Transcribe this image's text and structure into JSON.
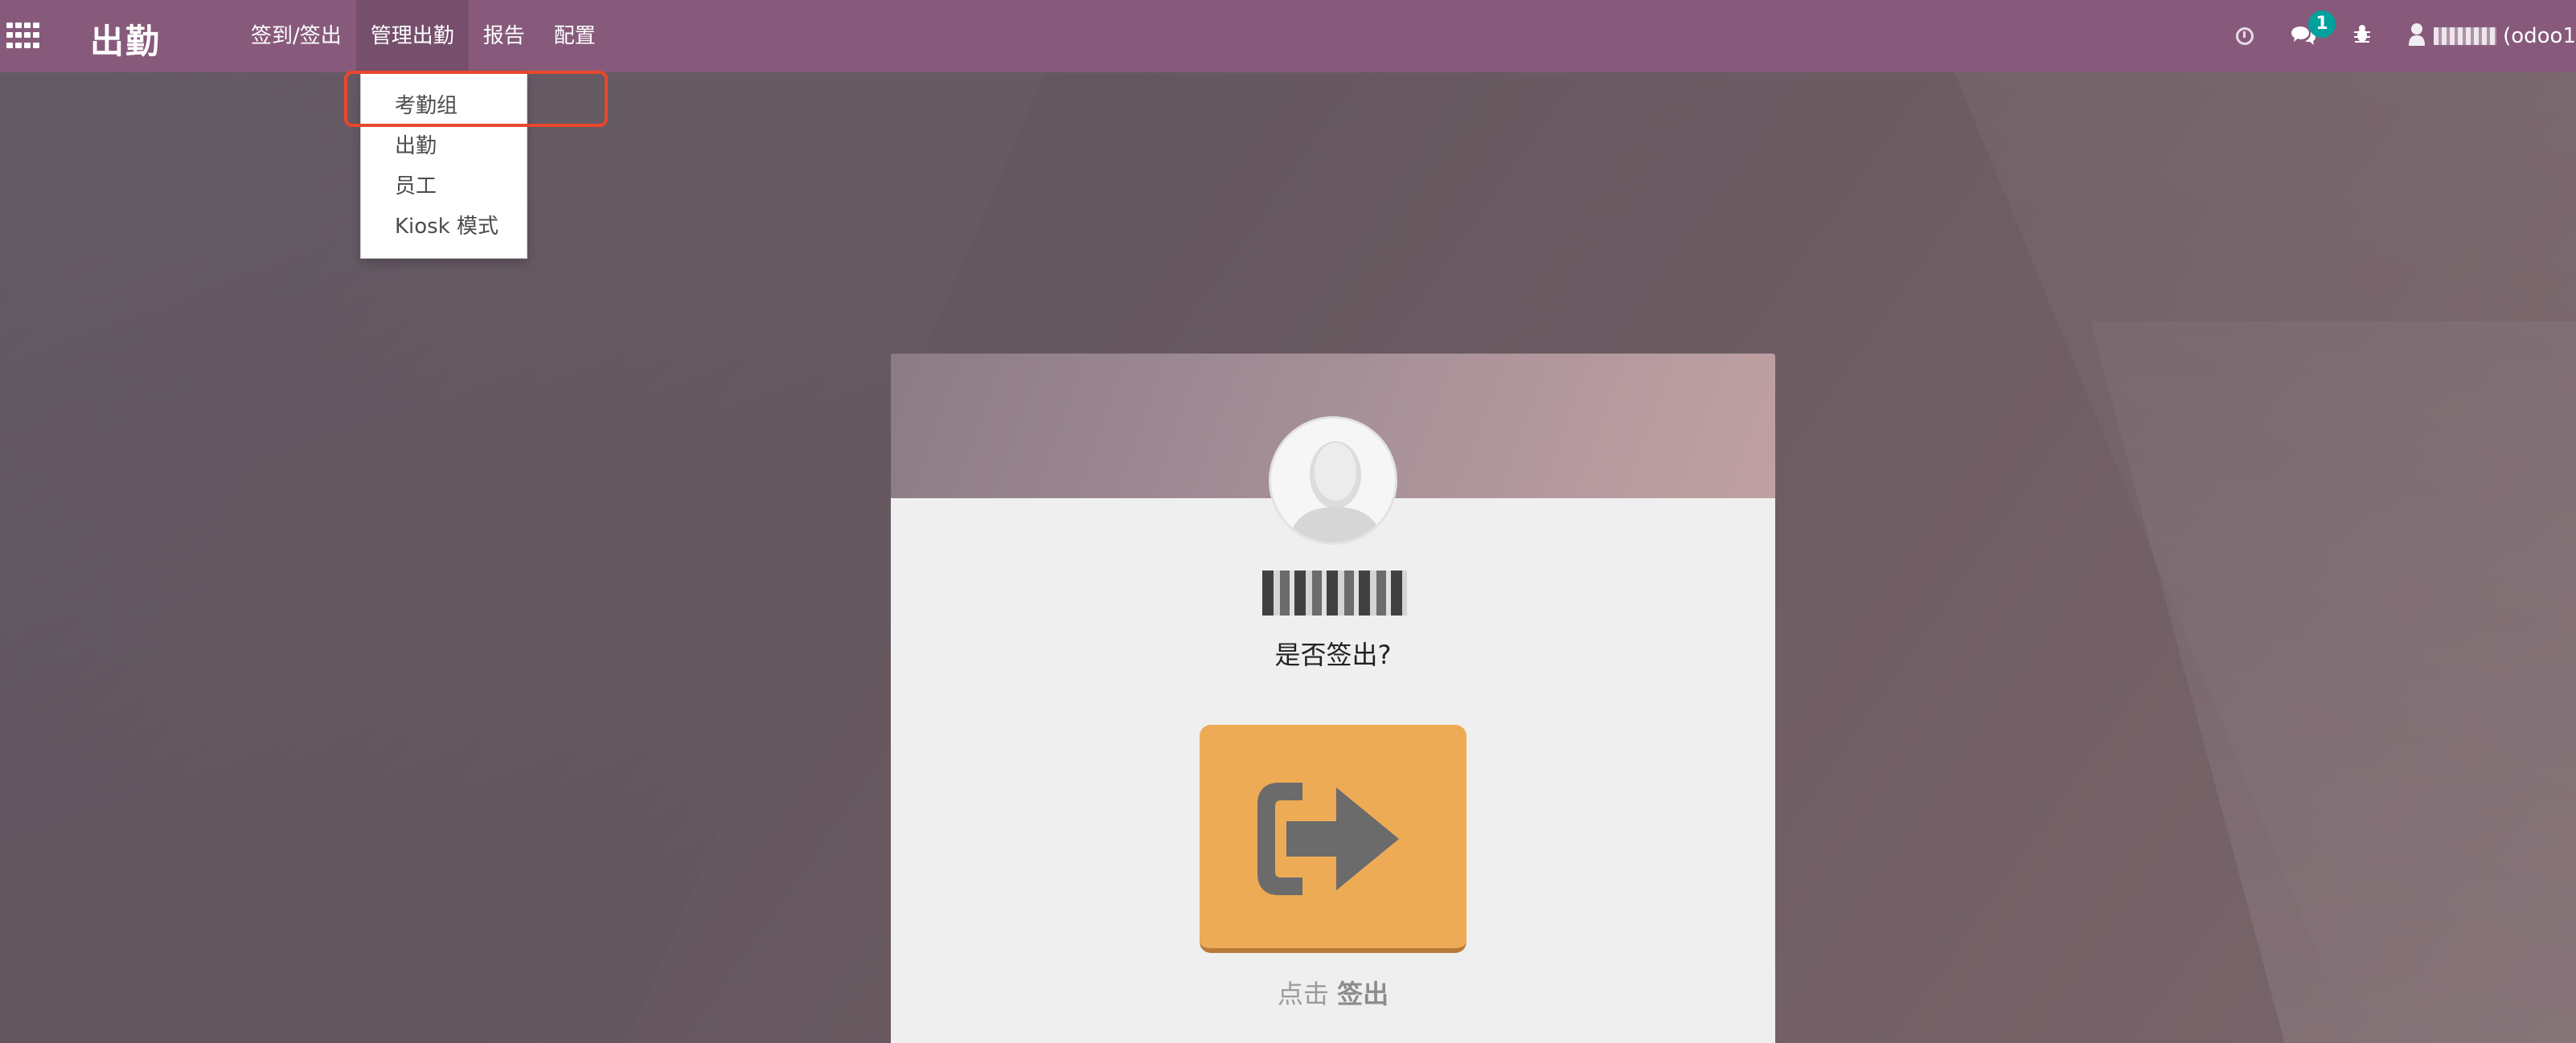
{
  "navbar": {
    "app_title": "出勤",
    "menu": [
      {
        "label": "签到/签出"
      },
      {
        "label": "管理出勤"
      },
      {
        "label": "报告"
      },
      {
        "label": "配置"
      }
    ],
    "chat_badge": "1",
    "user_label": "(odoo1"
  },
  "dropdown": {
    "items": [
      {
        "label": "考勤组"
      },
      {
        "label": "出勤"
      },
      {
        "label": "员工"
      },
      {
        "label": "Kiosk 模式"
      }
    ]
  },
  "kiosk": {
    "employee_name": "",
    "question": "是否签出?",
    "hint_prefix": "点击",
    "hint_action": "签出"
  },
  "colors": {
    "navbar": "#875a7b",
    "badge": "#00a09d",
    "signout_button": "#edab55",
    "highlight": "#e8482b"
  },
  "icons": [
    "apps-grid-icon",
    "clock-icon",
    "chat-icon",
    "bug-icon",
    "user-icon",
    "sign-out-icon"
  ]
}
